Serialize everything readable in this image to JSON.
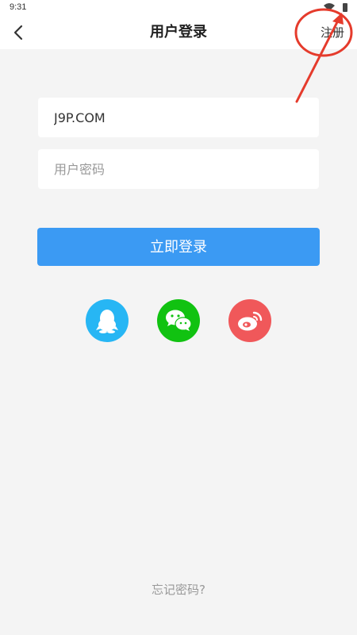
{
  "status_bar": {
    "time": "9:31",
    "icons": [
      "wifi-icon",
      "battery-icon"
    ]
  },
  "header": {
    "back_icon": "chevron-left-icon",
    "title": "用户登录",
    "register_label": "注册"
  },
  "form": {
    "username": {
      "value": "J9P.COM",
      "placeholder": ""
    },
    "password": {
      "value": "",
      "placeholder": "用户密码"
    },
    "login_label": "立即登录"
  },
  "social_login": {
    "items": [
      {
        "name": "qq",
        "icon": "qq-icon",
        "color": "#27b6f4"
      },
      {
        "name": "wechat",
        "icon": "wechat-icon",
        "color": "#11c211"
      },
      {
        "name": "weibo",
        "icon": "weibo-icon",
        "color": "#f0585a"
      }
    ]
  },
  "footer": {
    "forgot_password": "忘记密码?"
  },
  "colors": {
    "primary": "#3b9af3",
    "background": "#f4f4f4",
    "annotation": "#e53b2c"
  }
}
